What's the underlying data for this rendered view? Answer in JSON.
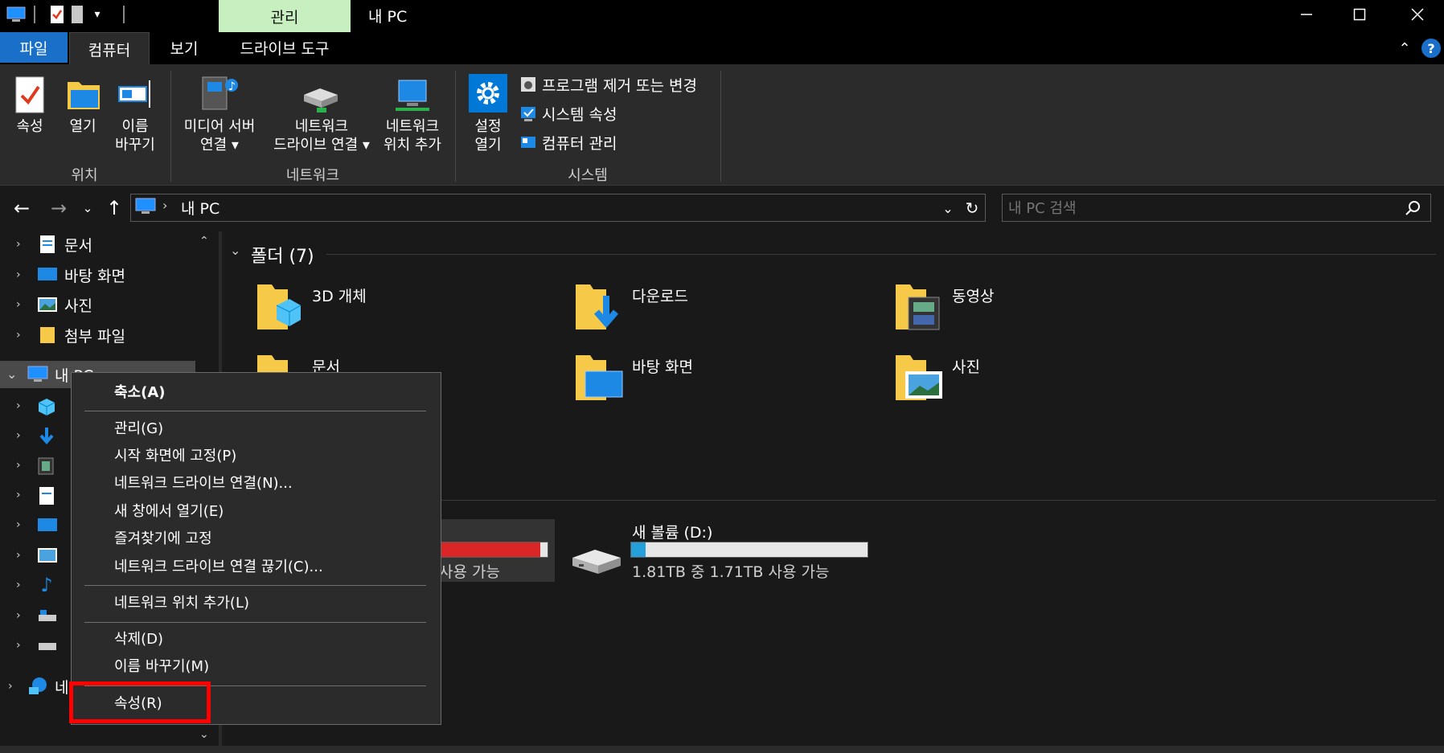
{
  "title": {
    "contextual_tab": "관리",
    "window_title": "내 PC"
  },
  "tabs": {
    "file": "파일",
    "computer": "컴퓨터",
    "view": "보기",
    "drive_tools": "드라이브 도구"
  },
  "ribbon": {
    "location": {
      "properties": "속성",
      "open": "열기",
      "rename_l1": "이름",
      "rename_l2": "바꾸기",
      "group": "위치"
    },
    "network": {
      "media_l1": "미디어 서버",
      "media_l2": "연결 ▾",
      "map_l1": "네트워크",
      "map_l2": "드라이브 연결 ▾",
      "add_l1": "네트워크",
      "add_l2": "위치 추가",
      "group": "네트워크"
    },
    "system": {
      "settings_l1": "설정",
      "settings_l2": "열기",
      "uninstall": "프로그램 제거 또는 변경",
      "sys_props": "시스템 속성",
      "manage": "컴퓨터 관리",
      "group": "시스템"
    }
  },
  "address": {
    "path": "내 PC",
    "search_placeholder": "내 PC 검색"
  },
  "sidebar": {
    "documents": "문서",
    "desktop": "바탕 화면",
    "pictures": "사진",
    "attachments": "첨부 파일",
    "this_pc": "내 PC",
    "network": "네"
  },
  "content": {
    "folders_header": "폴더 (7)",
    "folders": [
      "3D 개체",
      "다운로드",
      "동영상",
      "문서",
      "바탕 화면",
      "사진"
    ],
    "drive_c_free": "사용 가능",
    "drive_d_name": "새 볼륨 (D:)",
    "drive_d_free": "1.81TB 중 1.71TB 사용 가능",
    "drive_c_usage": 0.93,
    "drive_d_usage": 0.06
  },
  "context_menu": {
    "collapse": "축소(A)",
    "manage": "관리(G)",
    "pin_start": "시작 화면에 고정(P)",
    "map_drive": "네트워크 드라이브 연결(N)...",
    "open_new": "새 창에서 열기(E)",
    "pin_fav": "즐겨찾기에 고정",
    "disconnect": "네트워크 드라이브 연결 끊기(C)...",
    "add_net": "네트워크 위치 추가(L)",
    "delete": "삭제(D)",
    "rename": "이름 바꾸기(M)",
    "properties": "속성(R)"
  },
  "colors": {
    "accent": "#0078d7",
    "highlight": "#ff0000",
    "contextual": "#c7efc0",
    "drive_bar_full": "#da2626"
  }
}
